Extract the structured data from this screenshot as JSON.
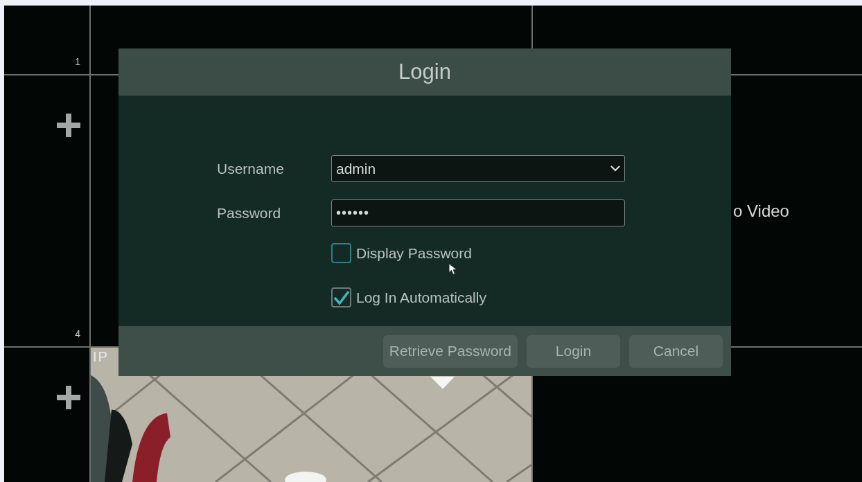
{
  "background": {
    "channel_numbers": [
      "1",
      "4"
    ],
    "camera_label": "IP",
    "status_text": "o Video"
  },
  "dialog": {
    "title": "Login",
    "fields": [
      {
        "label": "Username",
        "kind": "select",
        "value": "admin"
      },
      {
        "label": "Password",
        "kind": "password",
        "value": "••••••"
      }
    ],
    "checkboxes": [
      {
        "label": "Display Password",
        "checked": false
      },
      {
        "label": "Log In Automatically",
        "checked": true
      }
    ],
    "buttons": [
      "Retrieve Password",
      "Login",
      "Cancel"
    ]
  }
}
